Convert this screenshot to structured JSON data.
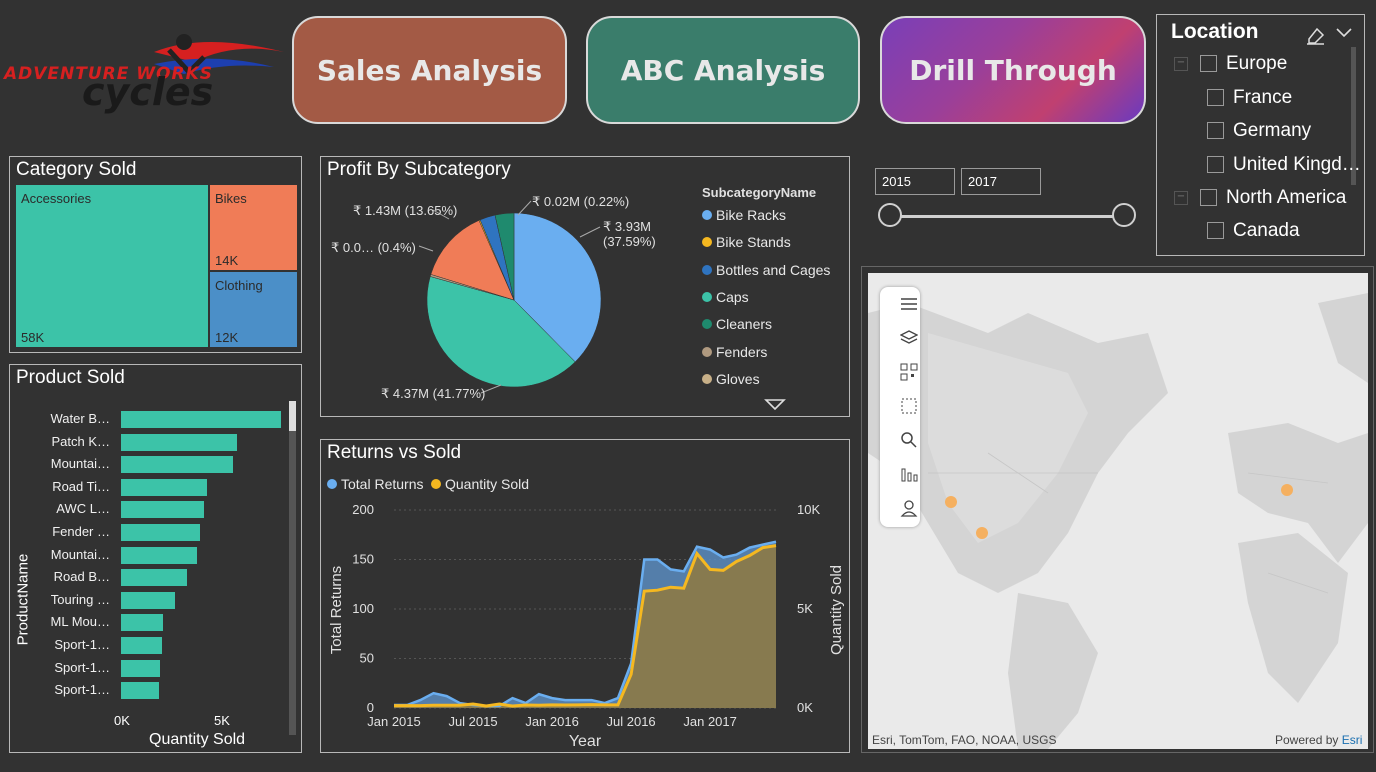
{
  "logo": {
    "text1": "ADVENTURE WORKS",
    "text2": "cycles"
  },
  "nav": {
    "sales": "Sales Analysis",
    "abc": "ABC Analysis",
    "drill": "Drill Through"
  },
  "location": {
    "title": "Location",
    "items": [
      {
        "label": "Europe",
        "level": 0
      },
      {
        "label": "France",
        "level": 1
      },
      {
        "label": "Germany",
        "level": 1
      },
      {
        "label": "United Kingd…",
        "level": 1
      },
      {
        "label": "North America",
        "level": 0
      },
      {
        "label": "Canada",
        "level": 1
      }
    ]
  },
  "slider": {
    "from": "2015",
    "to": "2017"
  },
  "category": {
    "title": "Category Sold",
    "cells": [
      {
        "label": "Accessories",
        "value": "58K",
        "color": "#3cc3a8"
      },
      {
        "label": "Bikes",
        "value": "14K",
        "color": "#f07c57"
      },
      {
        "label": "Clothing",
        "value": "12K",
        "color": "#4b8fc8"
      }
    ]
  },
  "product": {
    "title": "Product Sold",
    "ylabel": "ProductName",
    "xlabel": "Quantity Sold",
    "ticks": [
      "0K",
      "5K"
    ]
  },
  "profit": {
    "title": "Profit By Subcategory",
    "legend_title": "SubcategoryName",
    "legend": [
      {
        "name": "Bike Racks",
        "color": "#6aaef0"
      },
      {
        "name": "Bike Stands",
        "color": "#f5b820"
      },
      {
        "name": "Bottles and Cages",
        "color": "#2f74c0"
      },
      {
        "name": "Caps",
        "color": "#3cc3a8"
      },
      {
        "name": "Cleaners",
        "color": "#1f8a6e"
      },
      {
        "name": "Fenders",
        "color": "#b09a80"
      },
      {
        "name": "Gloves",
        "color": "#c8b088"
      }
    ],
    "labels": {
      "a": "₹ 0.02M (0.22%)",
      "b1": "₹ 3.93M",
      "b2": "(37.59%)",
      "c": "₹ 1.43M (13.65%)",
      "d": "₹ 0.0… (0.4%)",
      "e": "₹ 4.37M (41.77%)"
    }
  },
  "returns": {
    "title": "Returns vs Sold",
    "legend": [
      {
        "name": "Total Returns",
        "color": "#6aaef0"
      },
      {
        "name": "Quantity Sold",
        "color": "#f5b820"
      }
    ],
    "ylabel_left": "Total Returns",
    "ylabel_right": "Quantity Sold",
    "xlabel": "Year",
    "left_ticks": [
      "0",
      "50",
      "100",
      "150",
      "200"
    ],
    "right_ticks": [
      "0K",
      "5K",
      "10K"
    ],
    "x_ticks": [
      "Jan 2015",
      "Jul 2015",
      "Jan 2016",
      "Jul 2016",
      "Jan 2017"
    ]
  },
  "map": {
    "attribution": "Esri, TomTom, FAO, NOAA, USGS",
    "powered": "Powered by",
    "esri": "Esri"
  },
  "chart_data": [
    {
      "type": "bar",
      "title": "Product Sold",
      "orientation": "horizontal",
      "categories": [
        "Water B…",
        "Patch K…",
        "Mountai…",
        "Road Ti…",
        "AWC L…",
        "Fender …",
        "Mountai…",
        "Road B…",
        "Touring …",
        "ML Mou…",
        "Sport-1…",
        "Sport-1…",
        "Sport-1…"
      ],
      "values": [
        8000,
        5800,
        5600,
        4300,
        4150,
        3950,
        3800,
        3300,
        2700,
        2100,
        2050,
        1950,
        1900
      ],
      "xlabel": "Quantity Sold",
      "ylabel": "ProductName",
      "xlim": [
        0,
        8600
      ]
    },
    {
      "type": "pie",
      "title": "Profit By Subcategory",
      "slices": [
        {
          "name": "Bike Racks",
          "value": 3.93,
          "percent": 37.59,
          "color": "#6aaef0"
        },
        {
          "name": "Caps",
          "value": 4.37,
          "percent": 41.77,
          "color": "#3cc3a8"
        },
        {
          "name": "Fenders",
          "value": 0.04,
          "percent": 0.4,
          "color": "#b09a80"
        },
        {
          "name": "Gloves",
          "value": 1.43,
          "percent": 13.65,
          "color": "#f07c57"
        },
        {
          "name": "Bike Stands",
          "value": 0.02,
          "percent": 0.22,
          "color": "#f5b820"
        },
        {
          "name": "Bottles and Cages",
          "value": 0.3,
          "percent": 2.87,
          "color": "#2f74c0"
        },
        {
          "name": "Cleaners",
          "value": 0.35,
          "percent": 3.5,
          "color": "#1f8a6e"
        }
      ]
    },
    {
      "type": "area",
      "title": "Returns vs Sold",
      "x": [
        "Jan 2015",
        "Feb 2015",
        "Mar 2015",
        "Apr 2015",
        "May 2015",
        "Jun 2015",
        "Jul 2015",
        "Aug 2015",
        "Sep 2015",
        "Oct 2015",
        "Nov 2015",
        "Dec 2015",
        "Jan 2016",
        "Feb 2016",
        "Mar 2016",
        "Apr 2016",
        "May 2016",
        "Jun 2016",
        "Jul 2016",
        "Aug 2016",
        "Sep 2016",
        "Oct 2016",
        "Nov 2016",
        "Dec 2016",
        "Jan 2017",
        "Feb 2017",
        "Mar 2017",
        "Apr 2017",
        "May 2017",
        "Jun 2017"
      ],
      "series": [
        {
          "name": "Total Returns",
          "axis": "left",
          "values": [
            3,
            3,
            8,
            15,
            12,
            5,
            3,
            2,
            2,
            10,
            5,
            14,
            10,
            8,
            8,
            8,
            5,
            10,
            45,
            150,
            150,
            140,
            138,
            163,
            160,
            152,
            155,
            162,
            165,
            168
          ]
        },
        {
          "name": "Quantity Sold",
          "axis": "right",
          "values": [
            120,
            120,
            120,
            140,
            140,
            140,
            200,
            100,
            200,
            100,
            150,
            140,
            160,
            150,
            160,
            170,
            160,
            160,
            1700,
            5900,
            5950,
            6100,
            6050,
            7800,
            7000,
            6950,
            7400,
            7700,
            8100,
            8200
          ]
        }
      ],
      "ylim_left": [
        0,
        200
      ],
      "ylim_right": [
        0,
        10000
      ],
      "xlabel": "Year",
      "ylabel_left": "Total Returns",
      "ylabel_right": "Quantity Sold"
    }
  ]
}
